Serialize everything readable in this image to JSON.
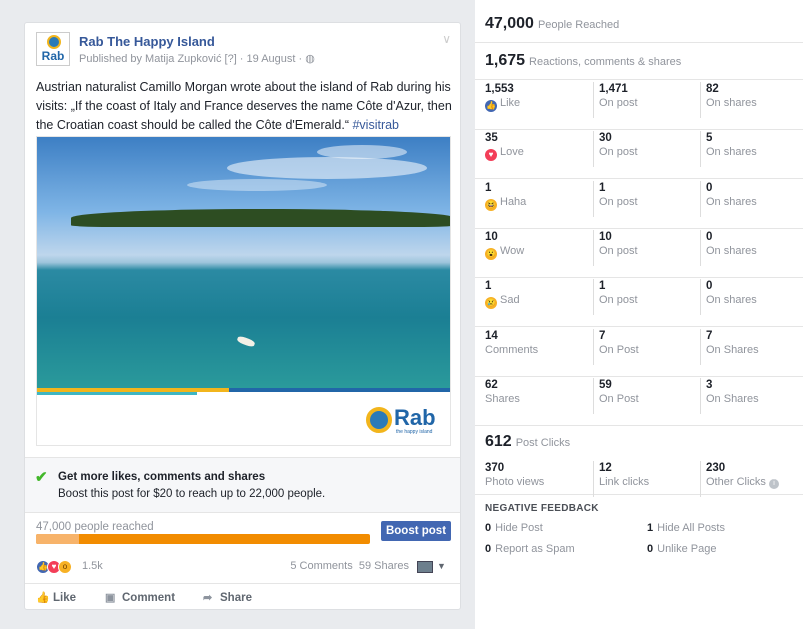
{
  "post": {
    "page_name": "Rab The Happy Island",
    "avatar_text": "Rab",
    "meta": "Published by Matija Zupković [?] · 19 August · ◍",
    "text": "Austrian naturalist Camillo Morgan wrote about the island of Rab during his visits: „If the coast of Italy and France deserves the name Côte d'Azur, then the Croatian coast should be called the Côte d'Emerald.“ ",
    "hashtag": "#visitrab",
    "brand_word": "Rab",
    "brand_tagline": "the happy island"
  },
  "boost": {
    "title": "Get more likes, comments and shares",
    "subtitle": "Boost this post for $20 to reach up to 22,000 people.",
    "reach_label": "47,000 people reached",
    "organic_fraction": 0.13,
    "button": "Boost post"
  },
  "engagement": {
    "reactions_count": "1.5k",
    "comments": "5 Comments",
    "shares": "59 Shares"
  },
  "actions": {
    "like": "Like",
    "comment": "Comment",
    "share": "Share"
  },
  "insights": {
    "reach": {
      "value": "47,000",
      "label": "People Reached"
    },
    "engagement": {
      "value": "1,675",
      "label": "Reactions, comments & shares"
    },
    "rows": [
      {
        "icon": "like",
        "total": "1,553",
        "label": "Like",
        "on_post": "1,471",
        "on_post_label": "On post",
        "on_shares": "82",
        "on_shares_label": "On shares"
      },
      {
        "icon": "love",
        "total": "35",
        "label": "Love",
        "on_post": "30",
        "on_post_label": "On post",
        "on_shares": "5",
        "on_shares_label": "On shares"
      },
      {
        "icon": "haha",
        "total": "1",
        "label": "Haha",
        "on_post": "1",
        "on_post_label": "On post",
        "on_shares": "0",
        "on_shares_label": "On shares"
      },
      {
        "icon": "wow",
        "total": "10",
        "label": "Wow",
        "on_post": "10",
        "on_post_label": "On post",
        "on_shares": "0",
        "on_shares_label": "On shares"
      },
      {
        "icon": "sad",
        "total": "1",
        "label": "Sad",
        "on_post": "1",
        "on_post_label": "On post",
        "on_shares": "0",
        "on_shares_label": "On shares"
      },
      {
        "icon": "",
        "total": "14",
        "label": "Comments",
        "on_post": "7",
        "on_post_label": "On Post",
        "on_shares": "7",
        "on_shares_label": "On Shares"
      },
      {
        "icon": "",
        "total": "62",
        "label": "Shares",
        "on_post": "59",
        "on_post_label": "On Post",
        "on_shares": "3",
        "on_shares_label": "On Shares"
      }
    ],
    "clicks": {
      "value": "612",
      "label": "Post Clicks"
    },
    "click_breakdown": [
      {
        "value": "370",
        "label": "Photo views"
      },
      {
        "value": "12",
        "label": "Link clicks"
      },
      {
        "value": "230",
        "label": "Other Clicks"
      }
    ],
    "negative": {
      "title": "NEGATIVE FEEDBACK",
      "items": [
        {
          "value": "0",
          "label": "Hide Post"
        },
        {
          "value": "1",
          "label": "Hide All Posts"
        },
        {
          "value": "0",
          "label": "Report as Spam"
        },
        {
          "value": "0",
          "label": "Unlike Page"
        }
      ]
    }
  }
}
